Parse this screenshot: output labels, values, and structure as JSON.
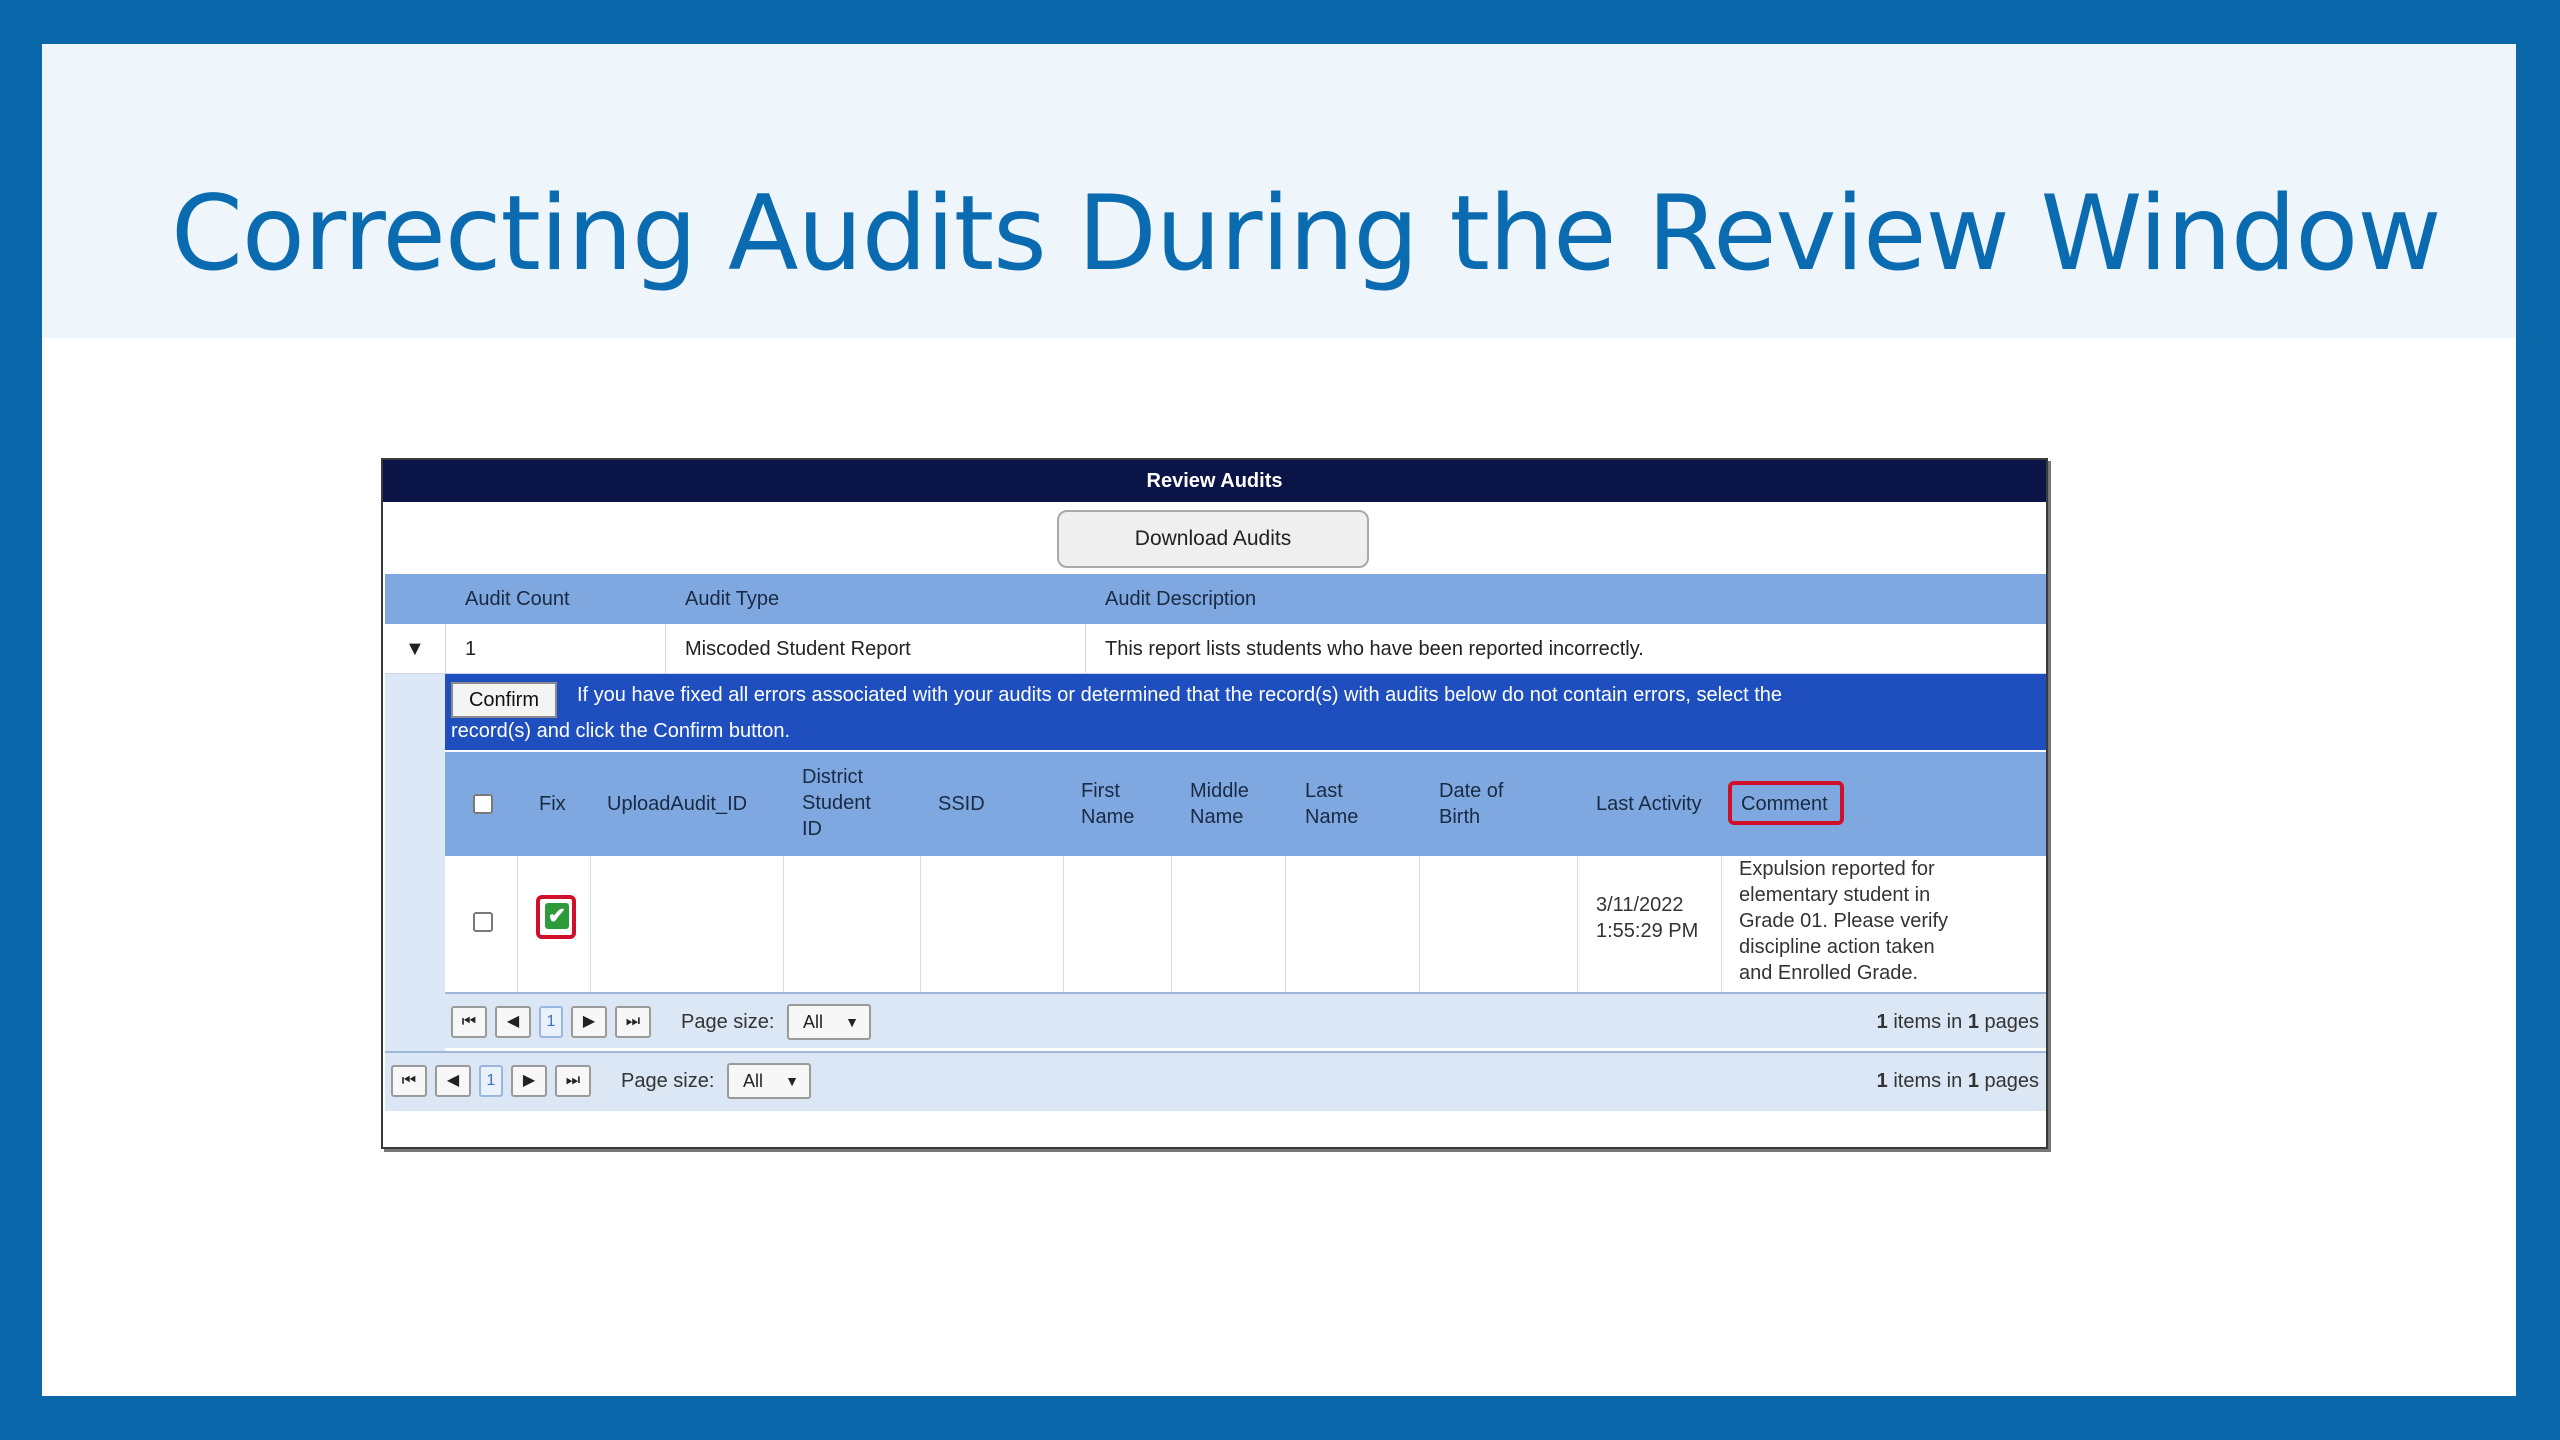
{
  "slide": {
    "title": "Correcting Audits During the Review Window"
  },
  "panel": {
    "header": "Review Audits",
    "download_button": "Download Audits"
  },
  "audit_table": {
    "columns": [
      "Audit Count",
      "Audit Type",
      "Audit Description"
    ],
    "row": {
      "count": "1",
      "type": "Miscoded Student Report",
      "description": "This report lists students who have been reported incorrectly."
    },
    "expander_icon": "triangle-down"
  },
  "confirm_bar": {
    "button": "Confirm",
    "message_line1": "If you have fixed all errors associated with your audits or determined that the record(s) with audits below do not contain errors, select the",
    "message_line2": "record(s) and click the Confirm button."
  },
  "records_table": {
    "columns": {
      "fix": "Fix",
      "upload_audit_id": "UploadAudit_ID",
      "district_student_id": [
        "District",
        "Student",
        "ID"
      ],
      "ssid": "SSID",
      "first_name": [
        "First",
        "Name"
      ],
      "middle_name": [
        "Middle",
        "Name"
      ],
      "last_name": [
        "Last",
        "Name"
      ],
      "date_of_birth": [
        "Date of",
        "Birth"
      ],
      "last_activity": "Last Activity",
      "comment": "Comment"
    },
    "row": {
      "fix_checked": true,
      "last_activity": [
        "3/11/2022",
        "1:55:29 PM"
      ],
      "comment": [
        "Expulsion reported for",
        "elementary student in",
        "Grade 01. Please verify",
        "discipline action taken",
        "and Enrolled Grade."
      ]
    },
    "highlight_color": "#d0102a"
  },
  "inner_pager": {
    "current_page": "1",
    "page_size_label": "Page size:",
    "page_size_value": "All",
    "info_count": "1",
    "info_mid": "items in",
    "info_pages": "1",
    "info_end": "pages"
  },
  "outer_pager": {
    "current_page": "1",
    "page_size_label": "Page size:",
    "page_size_value": "All",
    "info_count": "1",
    "info_mid": "items in",
    "info_pages": "1",
    "info_end": "pages"
  },
  "colors": {
    "frame_blue": "#0a68aa",
    "title_blue": "#0a6bb0",
    "header_navy": "#0b1446",
    "grid_header": "#7ea8df",
    "confirm_bar": "#1f4fbf"
  }
}
